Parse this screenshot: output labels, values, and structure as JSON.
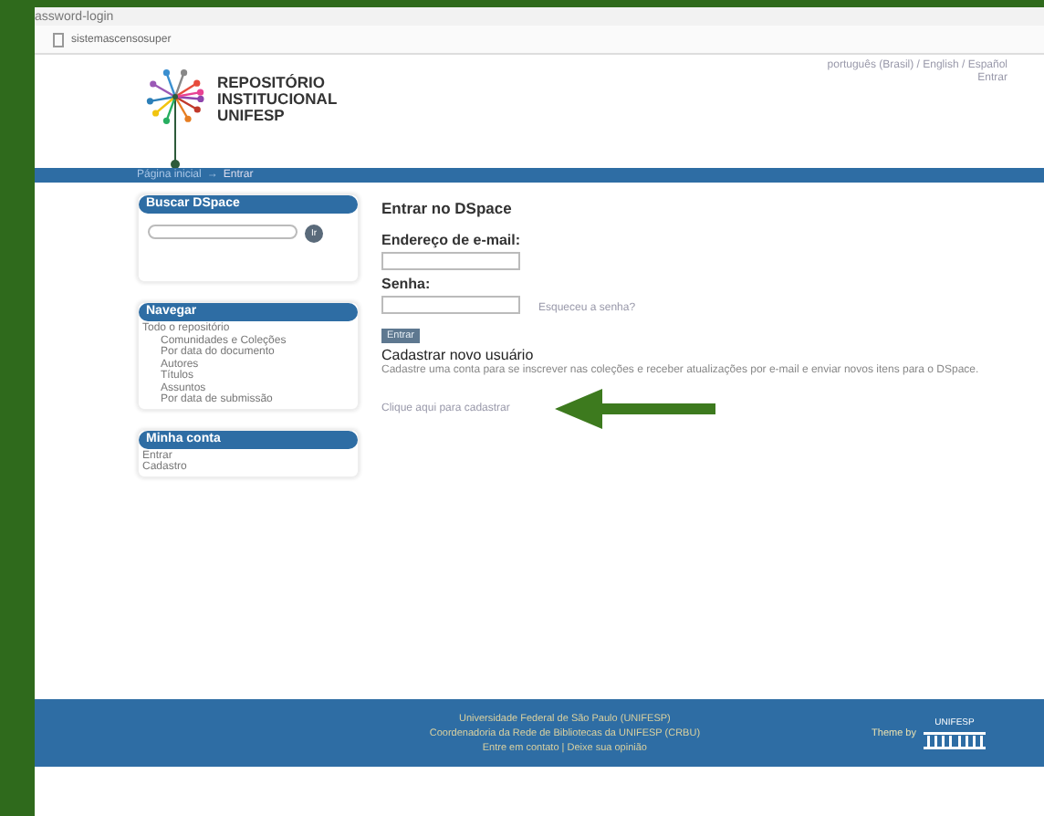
{
  "browser": {
    "tab_title": "assword-login",
    "address": "sistemascensosuper"
  },
  "header": {
    "logo_lines": [
      "REPOSITÓRIO",
      "INSTITUCIONAL",
      "UNIFESP"
    ],
    "languages": "português (Brasil) / English / Español",
    "login_link": "Entrar"
  },
  "breadcrumb": {
    "home": "Página inicial",
    "separator": "→",
    "current": "Entrar"
  },
  "sidebar": [
    {
      "kind": "search",
      "title": "Buscar DSpace",
      "button": "Ir"
    },
    {
      "kind": "links",
      "title": "Navegar",
      "items": [
        {
          "label": "Todo o repositório",
          "children": [
            {
              "label": "Comunidades e Coleções"
            },
            {
              "label": "Por data do documento"
            },
            {
              "label": "Autores"
            },
            {
              "label": "Títulos"
            },
            {
              "label": "Assuntos"
            },
            {
              "label": "Por data de submissão"
            }
          ]
        }
      ]
    },
    {
      "kind": "links",
      "title": "Minha conta",
      "items": [
        {
          "label": "Entrar"
        },
        {
          "label": "Cadastro"
        }
      ]
    }
  ],
  "main": {
    "title": "Entrar no DSpace",
    "email_label": "Endereço de e-mail:",
    "password_label": "Senha:",
    "forgot_link": "Esqueceu a senha?",
    "submit": "Entrar",
    "register_title": "Cadastrar novo usuário",
    "register_text": "Cadastre uma conta para se inscrever nas coleções e receber atualizações por e-mail e enviar novos itens para o DSpace.",
    "register_link": "Clique aqui para cadastrar"
  },
  "footer": {
    "lines": [
      "Universidade Federal de São Paulo (UNIFESP)",
      "Coordenadoria da Rede de Bibliotecas da UNIFESP (CRBU)"
    ],
    "contact_link": "Entre em contato",
    "contact_sep": "|",
    "feedback_link": "Deixe sua opinião",
    "theme": "Theme by",
    "logo_text": "UNIFESP"
  }
}
